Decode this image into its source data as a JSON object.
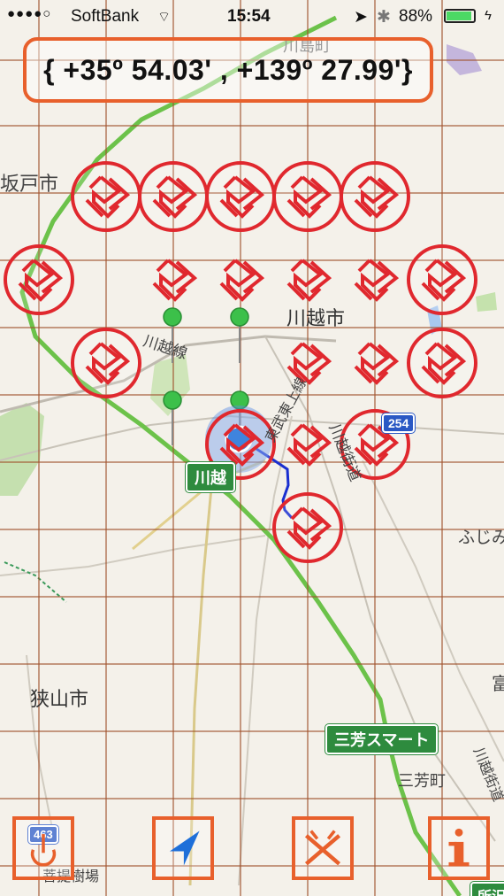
{
  "status_bar": {
    "carrier": "SoftBank",
    "time": "15:54",
    "battery": "88%",
    "signal_dots": 4
  },
  "coordinate_display": "{ +35º 54.03' , +139º 27.99'}",
  "map_labels": {
    "kawajima": "川島町",
    "sakado": "坂戸市",
    "kawagoe_city": "川越市",
    "kawagoe_line": "川越線",
    "tobu_tojo": "東武東上線",
    "kawagoe_kaido": "川越街道",
    "fujimino": "ふじみ",
    "sayama": "狭山市",
    "miyoshi": "三芳町",
    "tomi": "富",
    "kawagoe_kaido_2": "川越街道",
    "tokorozawa_partial": "所沢",
    "cut_label": "菩提樹場"
  },
  "road_shields": {
    "kawagoe_station": "川越",
    "miyoshi_smart": "三芳スマート",
    "route_254": "254",
    "route_463": "463"
  },
  "toolbar": {
    "power_icon": "power-icon",
    "locate_icon": "navigation-arrow-icon",
    "map_icon": "map-symbol-icon",
    "info_icon": "info-icon"
  },
  "colors": {
    "accent_orange": "#e8602c",
    "marker_red": "#e0282e",
    "grid_brown": "#a0522d",
    "highway_green": "#6cc24a",
    "route_blue": "#1a2fd0",
    "location_blue": "#1e6fd9"
  }
}
